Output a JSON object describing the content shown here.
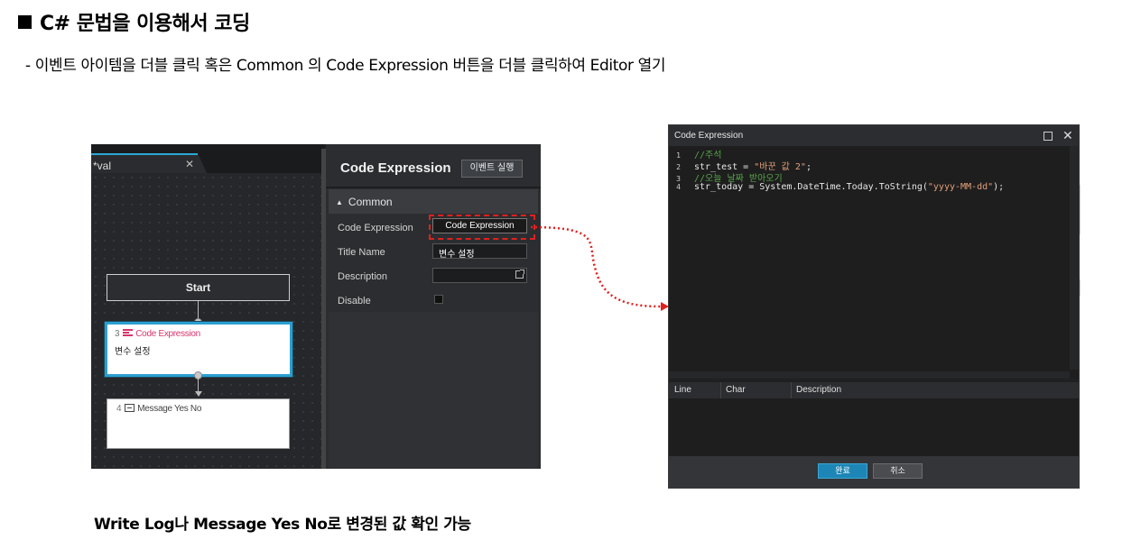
{
  "doc": {
    "heading": "C# 문법을 이용해서 코딩",
    "subtext": "- 이벤트 아이템을 더블 클릭 혹은 Common 의 Code Expression 버튼을 더블 클릭하여 Editor 열기",
    "bottom_note": "Write Log나 Message Yes No로 변경된 값 확인 가능"
  },
  "designer": {
    "tab": {
      "label": "*val",
      "close": "✕"
    },
    "nodes": {
      "start": {
        "label": "Start"
      },
      "code": {
        "index": "3",
        "type": "Code Expression",
        "body": "변수 설정"
      },
      "msg": {
        "index": "4",
        "type": "Message Yes No"
      }
    }
  },
  "properties": {
    "title": "Code Expression",
    "run_button": "이벤트 실행",
    "section": "Common",
    "rows": {
      "code_expression": {
        "label": "Code Expression",
        "value": "Code Expression"
      },
      "title_name": {
        "label": "Title Name",
        "value": "변수 설정"
      },
      "description": {
        "label": "Description",
        "value": ""
      },
      "disable": {
        "label": "Disable"
      }
    }
  },
  "dialog": {
    "title": "Code Expression",
    "close": "✕",
    "code_lines": [
      {
        "n": "1",
        "parts": [
          {
            "t": "//주석",
            "k": "comment"
          }
        ]
      },
      {
        "n": "2",
        "parts": [
          {
            "t": "str_test = ",
            "k": "plain"
          },
          {
            "t": "\"바꾼 값 2\"",
            "k": "str"
          },
          {
            "t": ";",
            "k": "plain"
          }
        ]
      },
      {
        "n": "3",
        "parts": [
          {
            "t": "//오늘 날짜 받아오기",
            "k": "comment"
          }
        ]
      },
      {
        "n": "4",
        "parts": [
          {
            "t": "str_today = System.DateTime.Today.ToString(",
            "k": "plain"
          },
          {
            "t": "\"yyyy-MM-dd\"",
            "k": "str"
          },
          {
            "t": ");",
            "k": "plain"
          }
        ]
      }
    ],
    "columns": {
      "line": "Line",
      "char": "Char",
      "description": "Description"
    },
    "ok": "완료",
    "cancel": "취소"
  },
  "colors": {
    "accent_blue": "#2a9fd0",
    "highlight_red": "#e02020",
    "node_type_pink": "#d9346a",
    "comment_green": "#57a64a",
    "string_orange": "#e3a07a"
  }
}
